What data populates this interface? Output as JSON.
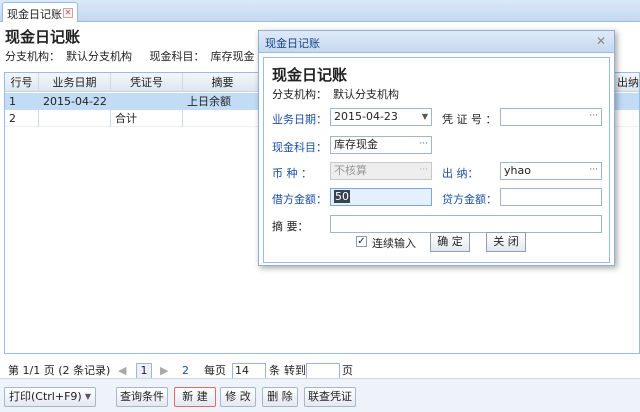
{
  "tab": {
    "title": "现金日记账"
  },
  "header": {
    "title": "现金日记账",
    "org_label": "分支机构：",
    "org_value": "默认分支机构",
    "subject_label": "现金科目：",
    "subject_value": "库存现金"
  },
  "grid": {
    "columns": [
      "行号",
      "业务日期",
      "凭证号",
      "摘要",
      "出纳"
    ],
    "rows": [
      {
        "no": "1",
        "date": "2015-04-22",
        "voucher": "",
        "summary": "上日余额"
      },
      {
        "no": "2",
        "date": "",
        "voucher": "合计",
        "summary": ""
      }
    ]
  },
  "pager": {
    "info": "第 1/1 页 (2 条记录)",
    "current_page": "1",
    "next_page": "2",
    "per_page_label": "每页",
    "per_page_value": "14",
    "unit": "条",
    "goto_label": "转到",
    "goto_value": "",
    "page_unit": "页"
  },
  "toolbar": {
    "print": "打印(Ctrl+F9)",
    "query": "查询条件",
    "new": "新 建",
    "edit": "修 改",
    "delete": "删 除",
    "linked": "联查凭证"
  },
  "dialog": {
    "title": "现金日记账",
    "heading": "现金日记账",
    "org_label": "分支机构：",
    "org_value": "默认分支机构",
    "date_label": "业务日期：",
    "date_value": "2015-04-23",
    "voucher_label": "凭 证 号 ：",
    "voucher_value": "",
    "subject_label": "现金科目：",
    "subject_value": "库存现金",
    "currency_label": "币    种 ：",
    "currency_value": "不核算",
    "cashier_label": "出    纳：",
    "cashier_value": "yhao",
    "debit_label": "借方金额：",
    "debit_value": "50",
    "credit_label": "贷方金额：",
    "credit_value": "",
    "memo_label": "摘    要：",
    "memo_value": "",
    "continuous_label": "连续输入",
    "continuous_checked": true,
    "ok": "确 定",
    "close": "关 闭"
  }
}
